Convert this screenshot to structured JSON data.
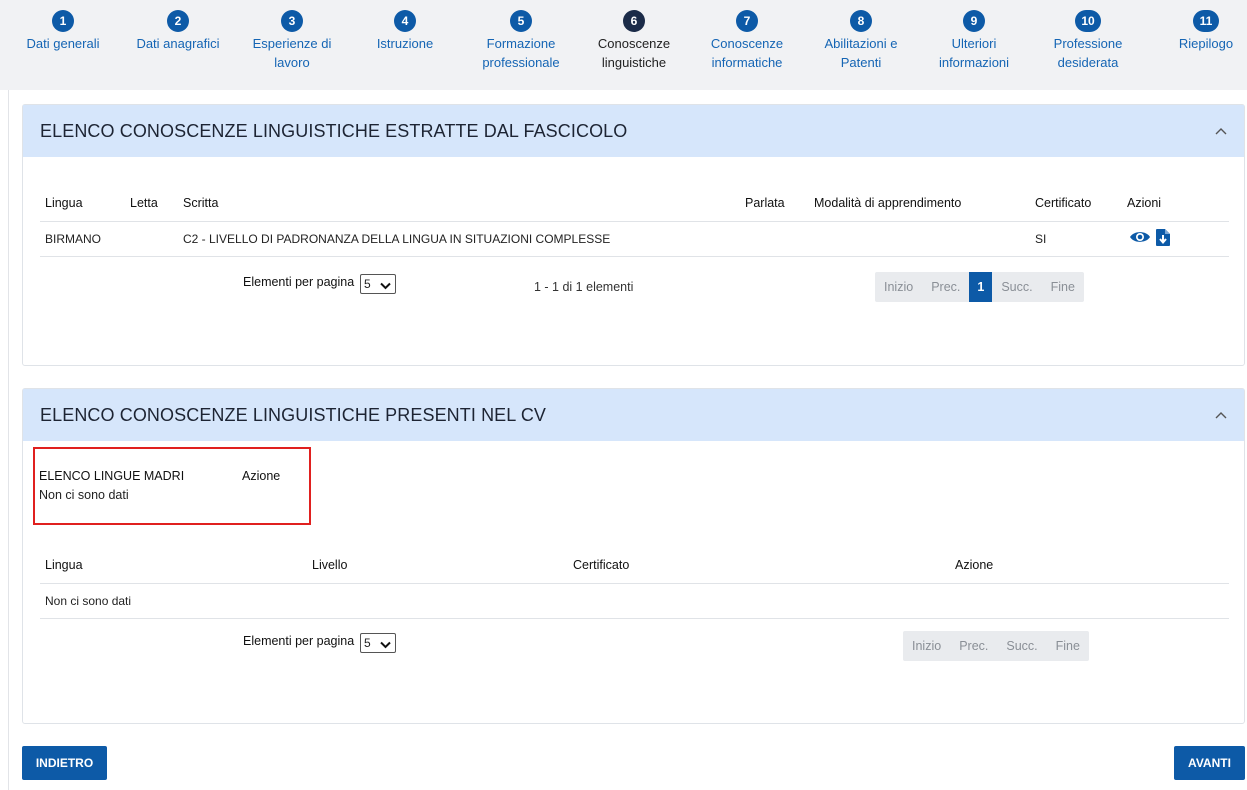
{
  "steps": [
    {
      "num": "1",
      "label": "Dati generali",
      "label2": ""
    },
    {
      "num": "2",
      "label": "Dati anagrafici",
      "label2": ""
    },
    {
      "num": "3",
      "label": "Esperienze di",
      "label2": "lavoro"
    },
    {
      "num": "4",
      "label": "Istruzione",
      "label2": ""
    },
    {
      "num": "5",
      "label": "Formazione",
      "label2": "professionale"
    },
    {
      "num": "6",
      "label": "Conoscenze",
      "label2": "linguistiche"
    },
    {
      "num": "7",
      "label": "Conoscenze",
      "label2": "informatiche"
    },
    {
      "num": "8",
      "label": "Abilitazioni e",
      "label2": "Patenti"
    },
    {
      "num": "9",
      "label": "Ulteriori",
      "label2": "informazioni"
    },
    {
      "num": "10",
      "label": "Professione",
      "label2": "desiderata"
    },
    {
      "num": "11",
      "label": "Riepilogo",
      "label2": ""
    }
  ],
  "panel1": {
    "title": "ELENCO CONOSCENZE LINGUISTICHE ESTRATTE DAL FASCICOLO",
    "columns": {
      "lingua": "Lingua",
      "letta": "Letta",
      "scritta": "Scritta",
      "parlata": "Parlata",
      "modalita": "Modalità di apprendimento",
      "certificato": "Certificato",
      "azioni": "Azioni"
    },
    "row": {
      "lingua": "BIRMANO",
      "letta": "",
      "scritta": "C2 - LIVELLO DI PADRONANZA DELLA LINGUA IN SITUAZIONI COMPLESSE",
      "parlata": "",
      "modalita": "",
      "certificato": "SI"
    },
    "per_page_label": "Elementi per pagina",
    "per_page_value": "5",
    "range": "1 - 1 di 1 elementi",
    "pager": {
      "first": "Inizio",
      "prev": "Prec.",
      "current": "1",
      "next": "Succ.",
      "last": "Fine"
    }
  },
  "panel2": {
    "title": "ELENCO CONOSCENZE LINGUISTICHE PRESENTI NEL CV",
    "mother_header": "ELENCO LINGUE MADRI",
    "mother_action": "Azione",
    "mother_empty": "Non ci sono dati",
    "columns": {
      "lingua": "Lingua",
      "livello": "Livello",
      "certificato": "Certificato",
      "azione": "Azione"
    },
    "empty": "Non ci sono dati",
    "per_page_label": "Elementi per pagina",
    "per_page_value": "5",
    "pager": {
      "first": "Inizio",
      "prev": "Prec.",
      "next": "Succ.",
      "last": "Fine"
    }
  },
  "buttons": {
    "back": "INDIETRO",
    "next": "AVANTI"
  },
  "colors": {
    "primary": "#0d5aa7",
    "panel_header": "#d6e6fb",
    "highlight": "#e0201f"
  }
}
